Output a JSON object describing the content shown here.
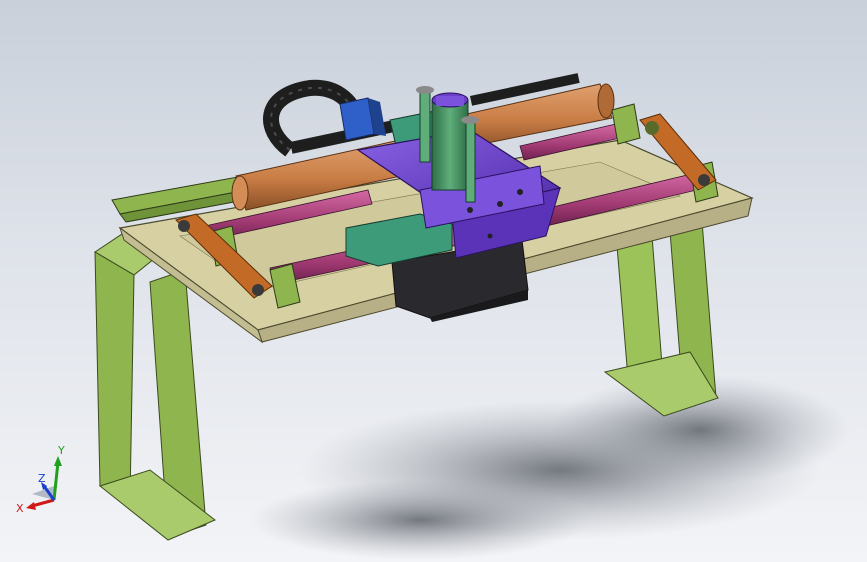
{
  "viewport": {
    "background_top": "#c9d0da",
    "background_bottom": "#f3f4f7"
  },
  "triad": {
    "x_label": "X",
    "y_label": "Y",
    "z_label": "Z",
    "x_color": "#d01818",
    "y_color": "#1fa01f",
    "z_color": "#1a3fd0"
  },
  "colors": {
    "frame_green": "#8fb54e",
    "plate_tan": "#d6d0a3",
    "rail_pink": "#b0447c",
    "rod_orange": "#c97d45",
    "arm_orange": "#c46a27",
    "carriage_purple": "#6a3fc8",
    "motor_dark": "#2a2a2e",
    "drag_chain": "#1e1e1e",
    "bracket_blue": "#2f5fc9",
    "block_teal": "#3d9b7a",
    "column_green": "#3b8a5a"
  }
}
